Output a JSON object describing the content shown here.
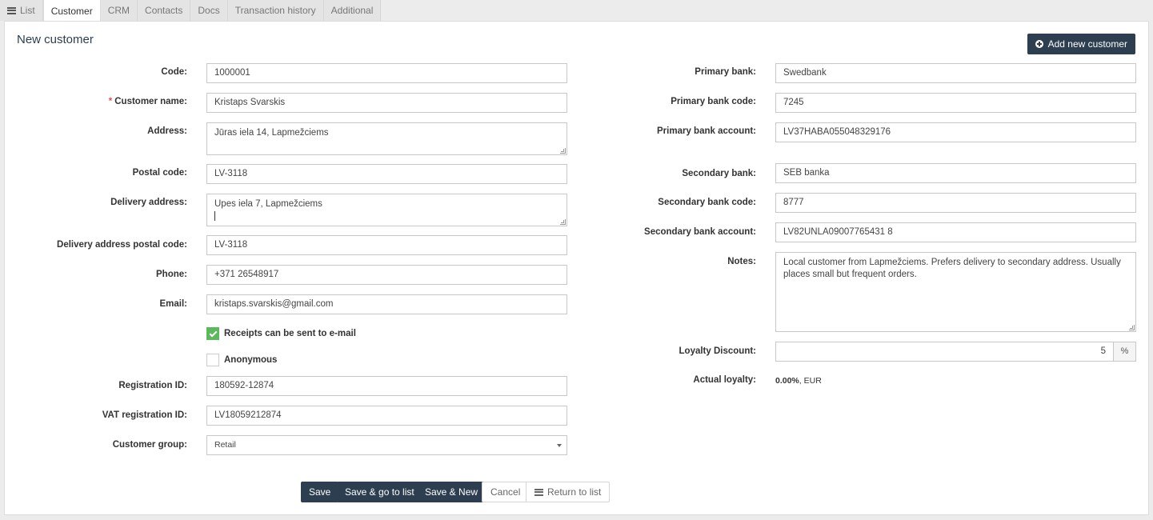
{
  "tabs": [
    "List",
    "Customer",
    "CRM",
    "Contacts",
    "Docs",
    "Transaction history",
    "Additional"
  ],
  "page": {
    "title": "New customer",
    "add_button": "Add new customer"
  },
  "left": {
    "code": {
      "label": "Code:",
      "value": "1000001"
    },
    "customer_name": {
      "label": "Customer name:",
      "required_mark": "*",
      "value": "Kristaps Svarskis"
    },
    "address": {
      "label": "Address:",
      "value": "Jūras iela 14, Lapmežciems"
    },
    "postal_code": {
      "label": "Postal code:",
      "value": "LV-3118"
    },
    "delivery_address": {
      "label": "Delivery address:",
      "value": "Upes iela 7, Lapmežciems"
    },
    "delivery_postal_code": {
      "label": "Delivery address postal code:",
      "value": "LV-3118"
    },
    "phone": {
      "label": "Phone:",
      "value": "+371 26548917"
    },
    "email": {
      "label": "Email:",
      "value": "kristaps.svarskis@gmail.com"
    },
    "receipts_checkbox": {
      "label": "Receipts can be sent to e-mail",
      "checked": true
    },
    "anonymous_checkbox": {
      "label": "Anonymous",
      "checked": false
    },
    "registration_id": {
      "label": "Registration ID:",
      "value": "180592-12874"
    },
    "vat_registration_id": {
      "label": "VAT registration ID:",
      "value": "LV18059212874"
    },
    "customer_group": {
      "label": "Customer group:",
      "value": "Retail"
    }
  },
  "right": {
    "primary_bank": {
      "label": "Primary bank:",
      "value": "Swedbank"
    },
    "primary_bank_code": {
      "label": "Primary bank code:",
      "value": "7245"
    },
    "primary_bank_account": {
      "label": "Primary bank account:",
      "value": "LV37HABA055048329176"
    },
    "secondary_bank": {
      "label": "Secondary bank:",
      "value": "SEB banka"
    },
    "secondary_bank_code": {
      "label": "Secondary bank code:",
      "value": "8777"
    },
    "secondary_bank_account": {
      "label": "Secondary bank account:",
      "value": "LV82UNLA09007765431 8"
    },
    "notes": {
      "label": "Notes:",
      "value": "Local customer from Lapmežciems. Prefers delivery to secondary address. Usually places small but frequent orders."
    },
    "loyalty_discount": {
      "label": "Loyalty Discount:",
      "value": "5",
      "unit": "%"
    },
    "actual_loyalty": {
      "label": "Actual loyalty:",
      "value": "0.00%",
      "currency": ", EUR"
    }
  },
  "actions": {
    "save": "Save",
    "save_go_list": "Save & go to list",
    "save_new": "Save & New",
    "cancel": "Cancel",
    "return_list": "Return to list"
  },
  "colors": {
    "primary": "#2c3e50",
    "checkbox_on": "#5cb85c",
    "required": "#d9534f"
  }
}
